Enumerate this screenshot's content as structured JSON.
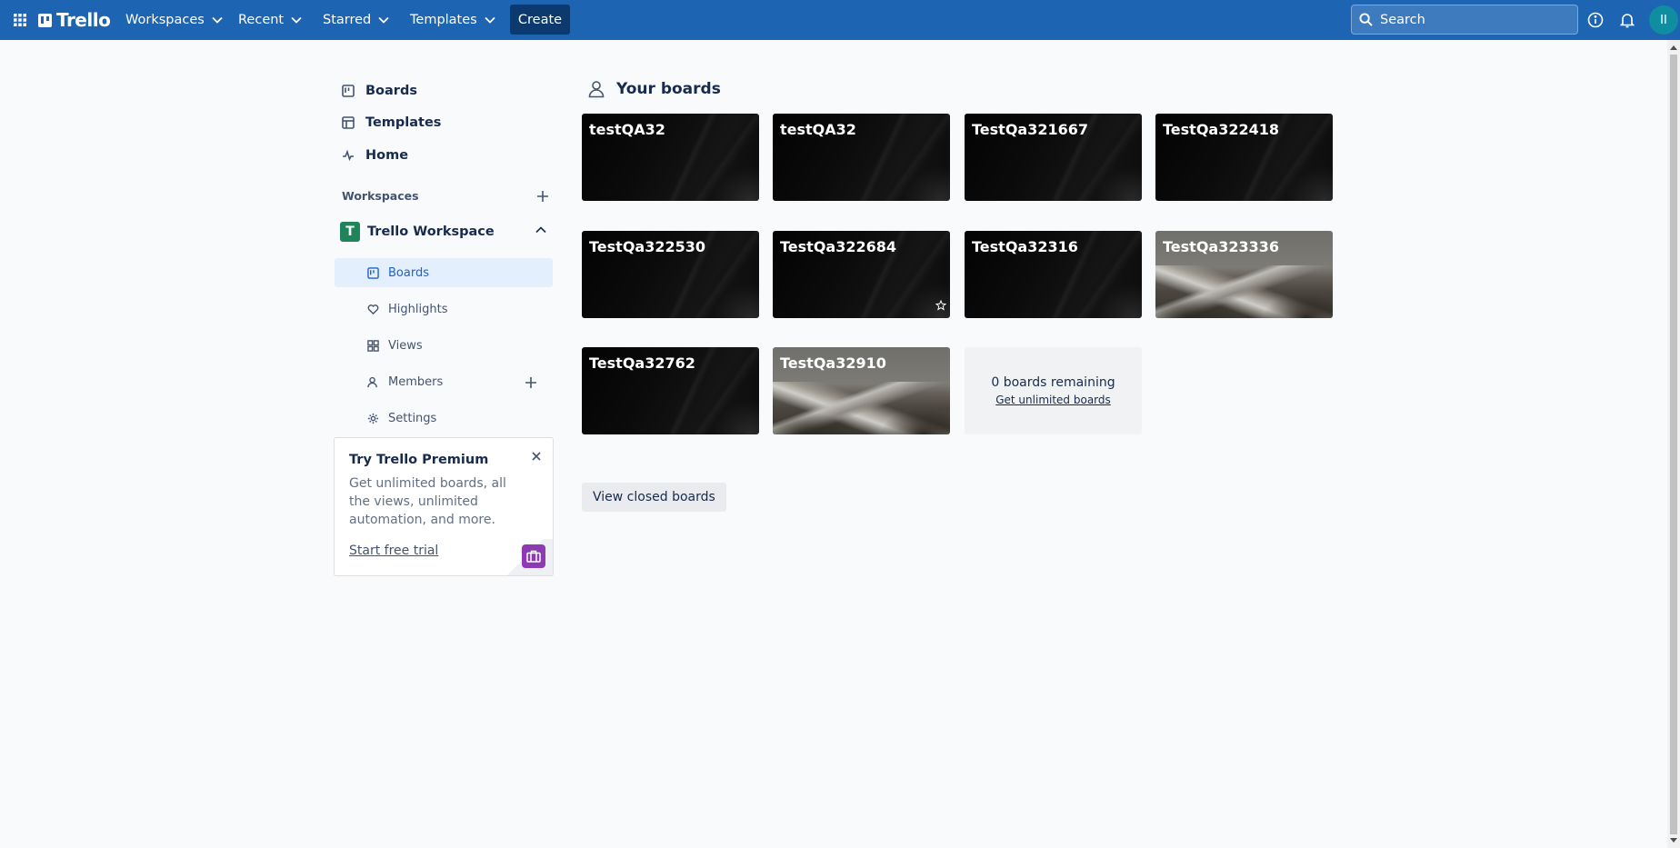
{
  "topbar": {
    "logo": "Trello",
    "nav": {
      "workspaces": "Workspaces",
      "recent": "Recent",
      "starred": "Starred",
      "templates": "Templates"
    },
    "create_label": "Create",
    "search_placeholder": "Search",
    "avatar_initials": "II"
  },
  "sidebar": {
    "links": {
      "boards": "Boards",
      "templates": "Templates",
      "home": "Home"
    },
    "workspaces_heading": "Workspaces",
    "workspace": {
      "badge": "T",
      "name": "Trello Workspace",
      "color": "#1f845a",
      "items": {
        "boards": "Boards",
        "highlights": "Highlights",
        "views": "Views",
        "members": "Members",
        "settings": "Settings"
      }
    }
  },
  "premium": {
    "title": "Try Trello Premium",
    "body": "Get unlimited boards, all the views, unlimited automation, and more.",
    "cta": "Start free trial"
  },
  "main": {
    "section_title": "Your boards",
    "boards": [
      {
        "name": "testQA32",
        "background": "dark"
      },
      {
        "name": "testQA32",
        "background": "dark"
      },
      {
        "name": "TestQa321667",
        "background": "dark"
      },
      {
        "name": "TestQa322418",
        "background": "dark"
      },
      {
        "name": "TestQa322530",
        "background": "dark"
      },
      {
        "name": "TestQa322684",
        "background": "dark"
      },
      {
        "name": "TestQa32316",
        "background": "dark"
      },
      {
        "name": "TestQa323336",
        "background": "mountain"
      },
      {
        "name": "TestQa32762",
        "background": "dark"
      },
      {
        "name": "TestQa32910",
        "background": "mountain"
      }
    ],
    "remaining": {
      "count": "0 boards remaining",
      "link": "Get unlimited boards"
    },
    "closed_boards_label": "View closed boards"
  },
  "colors": {
    "header": "#1d64b3",
    "create_button": "#0c3a6f",
    "active_item_bg": "#e4effe",
    "active_item_text": "#1d62ca",
    "premium_icon": "#8d3bb5"
  }
}
